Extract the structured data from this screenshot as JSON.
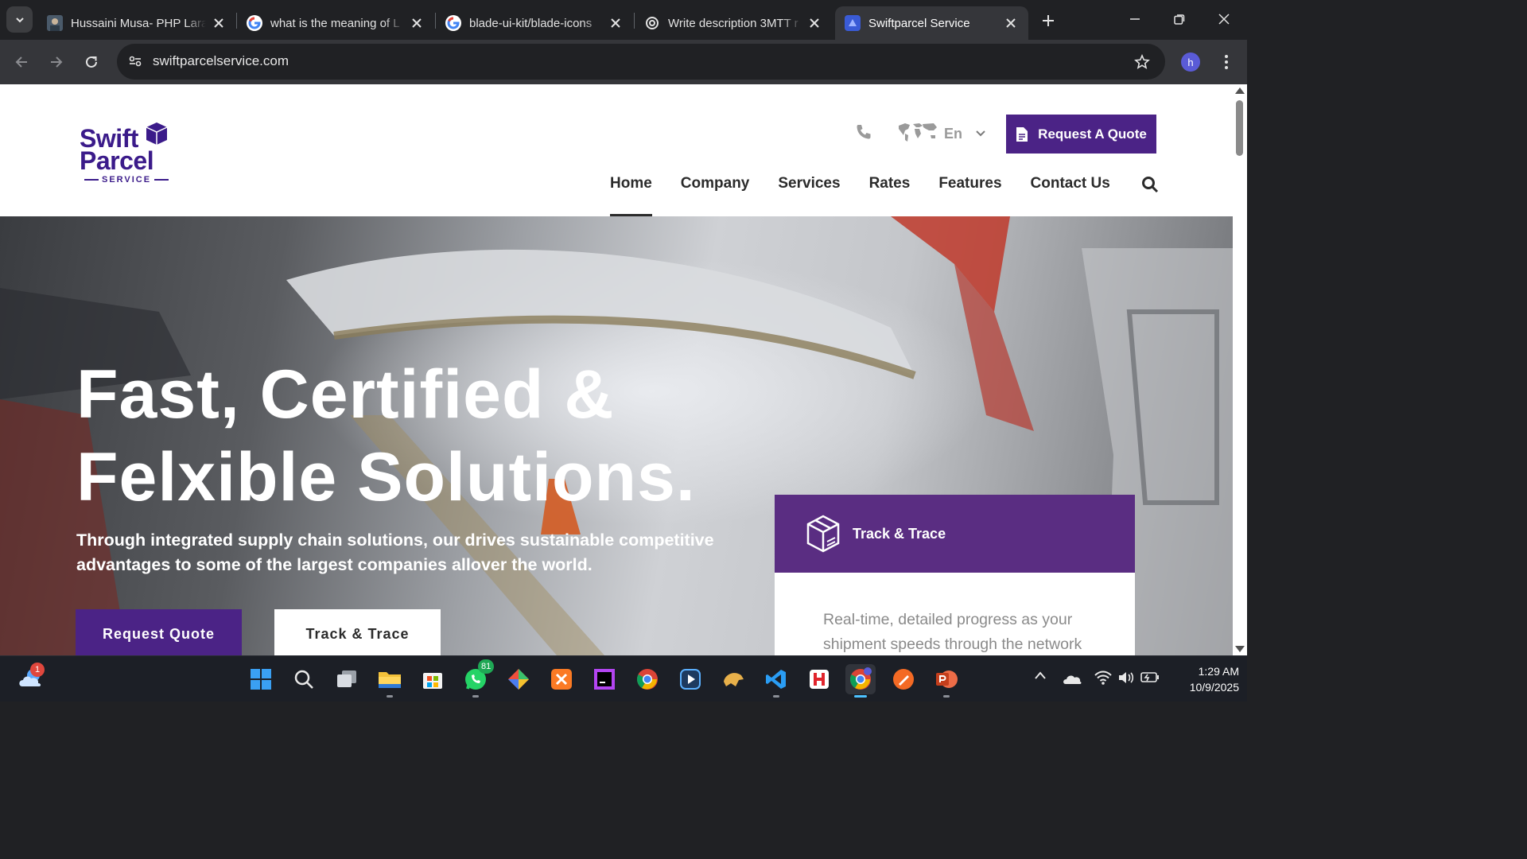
{
  "browser": {
    "tabs": [
      {
        "title": "Hussaini Musa- PHP Lara",
        "icon": "avatar-favicon"
      },
      {
        "title": "what is the meaning of L",
        "icon": "google-icon"
      },
      {
        "title": "blade-ui-kit/blade-icons",
        "icon": "google-icon"
      },
      {
        "title": "Write description 3MTT r",
        "icon": "chatgpt-icon"
      },
      {
        "title": "Swiftparcel Service",
        "icon": "swiftparcel-favicon",
        "active": true
      }
    ],
    "url": "swiftparcelservice.com",
    "profile_initial": "h"
  },
  "site": {
    "logo": {
      "line1": "Swift",
      "line2": "Parcel",
      "line3": "SERVICE"
    },
    "language": "En",
    "request_quote_label": "Request A Quote",
    "nav": [
      "Home",
      "Company",
      "Services",
      "Rates",
      "Features",
      "Contact Us"
    ],
    "active_nav": "Home",
    "hero": {
      "title_line1": "Fast, Certified &",
      "title_line2": "Felxible Solutions.",
      "subtitle": "Through integrated supply chain solutions, our drives sustainable competitive advantages to some of the largest companies allover the world.",
      "btn_quote": "Request Quote",
      "btn_track": "Track & Trace"
    },
    "track_card": {
      "title": "Track & Trace",
      "body": "Real-time, detailed progress as your shipment speeds through the network"
    },
    "colors": {
      "brand_purple": "#4b2386",
      "card_purple": "#5a2d82"
    }
  },
  "taskbar": {
    "weather_badge": "1",
    "whatsapp_badge": "81",
    "apps": [
      "start-icon",
      "search-icon",
      "task-view-icon",
      "file-explorer-icon",
      "store-icon",
      "whatsapp-icon",
      "git-icon",
      "xampp-icon",
      "phpstorm-icon",
      "chrome-icon",
      "media-player-icon",
      "dbeaver-icon",
      "vscode-icon",
      "heidisql-icon",
      "chrome-active-icon",
      "brush-icon",
      "powerpoint-icon"
    ],
    "time": "1:29 AM",
    "date": "10/9/2025"
  }
}
